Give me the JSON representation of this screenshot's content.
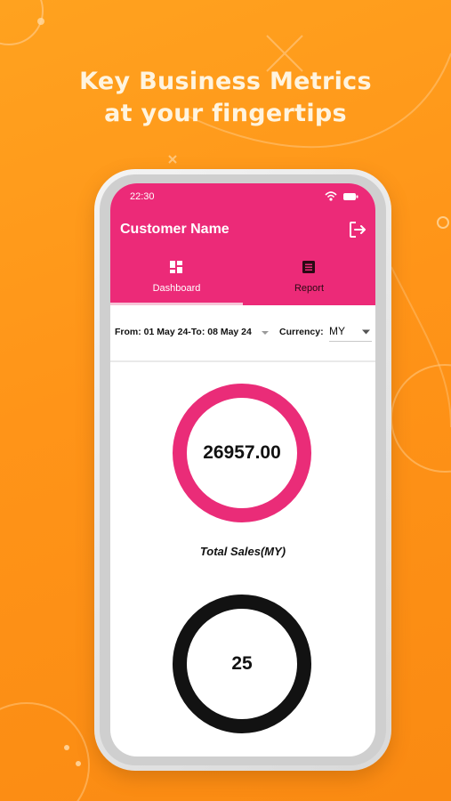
{
  "headline": {
    "line1": "Key Business Metrics",
    "line2": "at your fingertips"
  },
  "status_bar": {
    "time": "22:30",
    "icons": [
      "wifi-icon",
      "battery-icon"
    ]
  },
  "app_bar": {
    "title": "Customer Name",
    "logout_icon": "logout-icon"
  },
  "tabs": [
    {
      "label": "Dashboard",
      "icon": "dashboard-icon",
      "active": true
    },
    {
      "label": "Report",
      "icon": "report-icon",
      "active": false
    }
  ],
  "filters": {
    "date_range": "From: 01 May 24-To: 08 May 24",
    "currency_label": "Currency:",
    "currency_value": "MY"
  },
  "metrics": [
    {
      "value": "26957.00",
      "caption": "Total Sales(MY)"
    },
    {
      "value": "25"
    }
  ],
  "colors": {
    "background": "#ff9418",
    "accent": "#ec2a78",
    "dark_ring": "#121212"
  }
}
